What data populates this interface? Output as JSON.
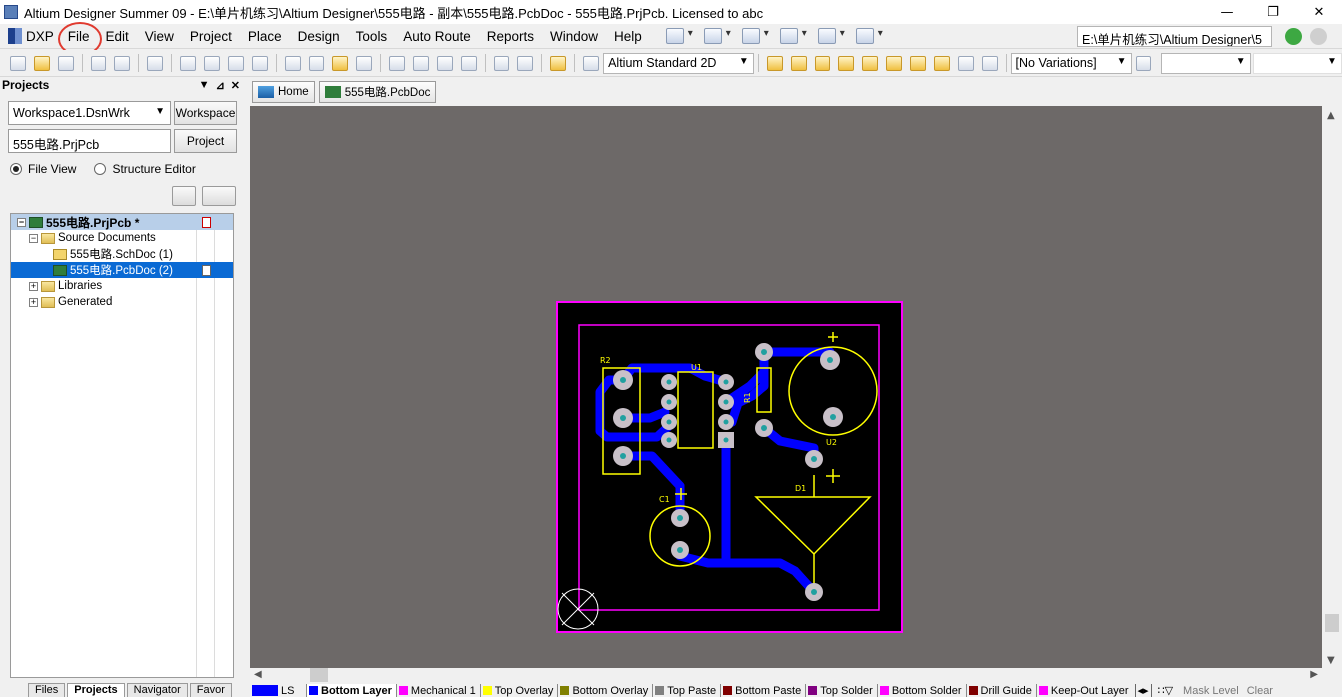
{
  "window": {
    "title": "Altium Designer Summer 09 - E:\\单片机练习\\Altium Designer\\555电路 - 副本\\555电路.PcbDoc - 555电路.PrjPcb. Licensed to abc",
    "minimize": "—",
    "restore": "❐",
    "close": "✕"
  },
  "menubar": {
    "dxp": "DXP",
    "items": [
      "File",
      "Edit",
      "View",
      "Project",
      "Place",
      "Design",
      "Tools",
      "Auto Route",
      "Reports",
      "Window",
      "Help"
    ],
    "path": "E:\\单片机练习\\Altium Designer\\5"
  },
  "toolbar2": {
    "view_combo": "Altium Standard 2D",
    "variations_combo": "[No Variations]",
    "extra_combo": ""
  },
  "panel": {
    "title": "Projects",
    "workspace_combo": "Workspace1.DsnWrk",
    "workspace_button": "Workspace",
    "project_field": "555电路.PrjPcb",
    "project_button": "Project",
    "radio_file_view": "File View",
    "radio_structure": "Structure Editor",
    "tree": {
      "project": "555电路.PrjPcb *",
      "source_documents": "Source Documents",
      "schdoc": "555电路.SchDoc (1)",
      "pcbdoc": "555电路.PcbDoc (2)",
      "libraries": "Libraries",
      "generated": "Generated"
    }
  },
  "bottom_tabs": [
    "Files",
    "Projects",
    "Navigator",
    "Favor"
  ],
  "doc_tabs": {
    "home": "Home",
    "pcb": "555电路.PcbDoc"
  },
  "pcb": {
    "labels": {
      "r2": "R2",
      "u1": "U1",
      "r1": "R1",
      "u2": "U2",
      "c1": "C1",
      "d1": "D1"
    },
    "colors": {
      "board": "#000000",
      "outline": "#ff00ff",
      "track": "#0000ff",
      "overlay": "#ffff00",
      "pad": "#c8c0c8",
      "hole": "#20a0a0"
    }
  },
  "layer_tabs": {
    "ls": "LS",
    "layers": [
      {
        "name": "Bottom Layer",
        "color": "#0000ff"
      },
      {
        "name": "Mechanical 1",
        "color": "#ff00ff"
      },
      {
        "name": "Top Overlay",
        "color": "#ffff00"
      },
      {
        "name": "Bottom Overlay",
        "color": "#808000"
      },
      {
        "name": "Top Paste",
        "color": "#808080"
      },
      {
        "name": "Bottom Paste",
        "color": "#800000"
      },
      {
        "name": "Top Solder",
        "color": "#800080"
      },
      {
        "name": "Bottom Solder",
        "color": "#ff00ff"
      },
      {
        "name": "Drill Guide",
        "color": "#800000"
      },
      {
        "name": "Keep-Out Layer",
        "color": "#ff00ff"
      }
    ],
    "mask_level": "Mask Level",
    "clear": "Clear"
  }
}
